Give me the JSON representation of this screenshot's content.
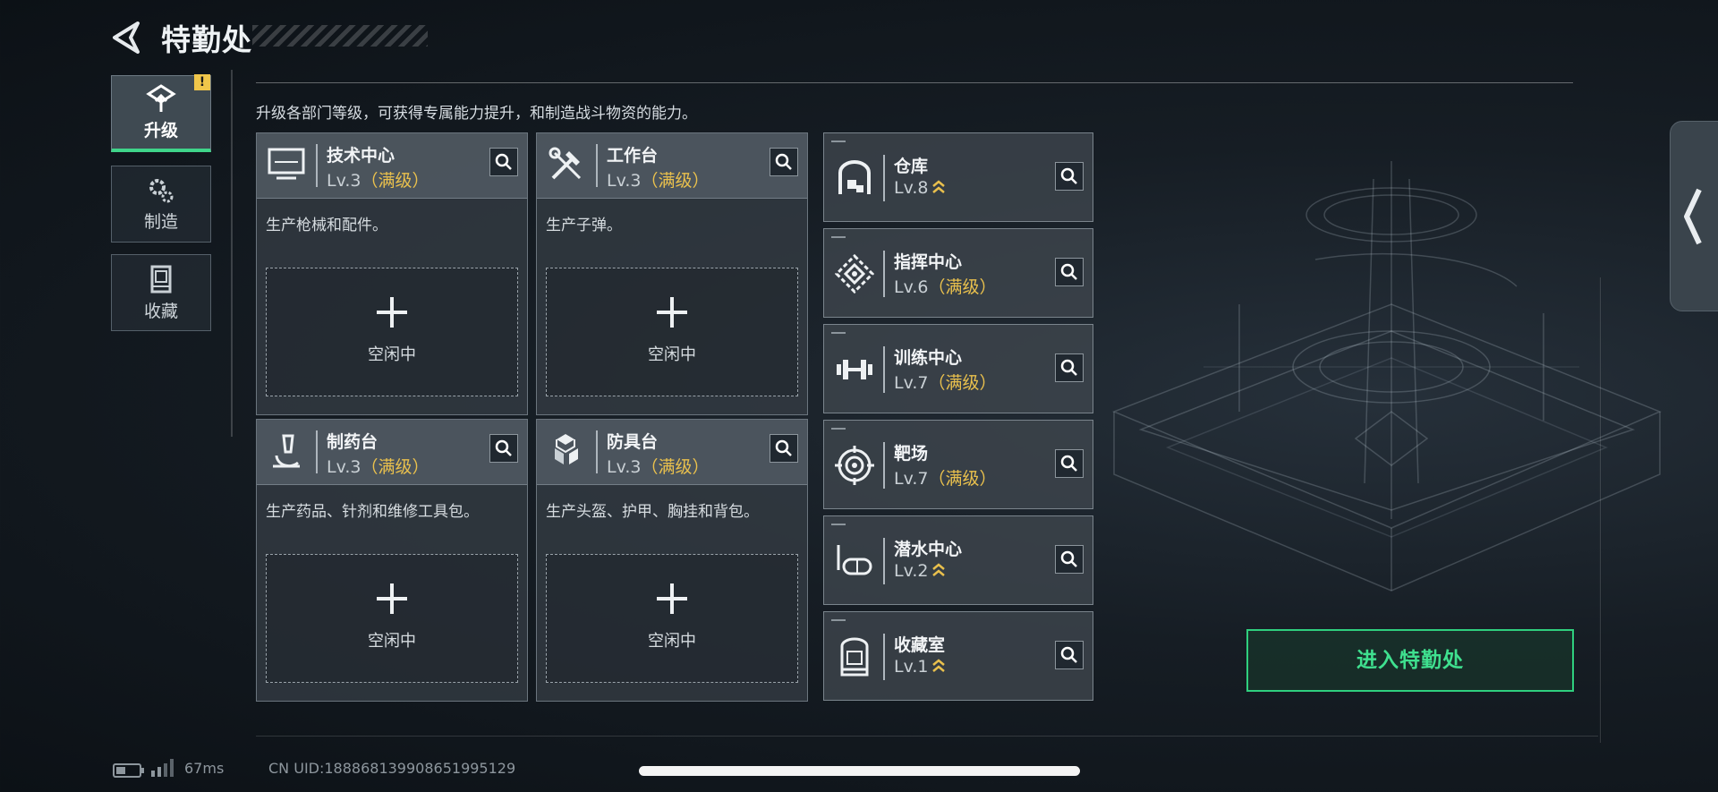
{
  "header": {
    "title": "特勤处"
  },
  "sidebar": {
    "items": [
      {
        "label": "升级",
        "active": true,
        "badge": "!"
      },
      {
        "label": "制造",
        "active": false
      },
      {
        "label": "收藏",
        "active": false
      }
    ]
  },
  "main": {
    "description": "升级各部门等级，可获得专属能力提升，和制造战斗物资的能力。",
    "workshops": [
      {
        "name": "技术中心",
        "level": "Lv.3",
        "max_tag": "（满级）",
        "desc": "生产枪械和配件。",
        "slot": "空闲中",
        "icon": "computer-icon"
      },
      {
        "name": "工作台",
        "level": "Lv.3",
        "max_tag": "（满级）",
        "desc": "生产子弹。",
        "slot": "空闲中",
        "icon": "tools-icon"
      },
      {
        "name": "制药台",
        "level": "Lv.3",
        "max_tag": "（满级）",
        "desc": "生产药品、针剂和维修工具包。",
        "slot": "空闲中",
        "icon": "microscope-icon"
      },
      {
        "name": "防具台",
        "level": "Lv.3",
        "max_tag": "（满级）",
        "desc": "生产头盔、护甲、胸挂和背包。",
        "slot": "空闲中",
        "icon": "armor-cubes-icon"
      }
    ],
    "facilities": [
      {
        "name": "仓库",
        "level": "Lv.8",
        "max_tag": "",
        "upgradable": true,
        "icon": "warehouse-icon"
      },
      {
        "name": "指挥中心",
        "level": "Lv.6",
        "max_tag": "（满级）",
        "upgradable": false,
        "icon": "command-icon"
      },
      {
        "name": "训练中心",
        "level": "Lv.7",
        "max_tag": "（满级）",
        "upgradable": false,
        "icon": "dumbbell-icon"
      },
      {
        "name": "靶场",
        "level": "Lv.7",
        "max_tag": "（满级）",
        "upgradable": false,
        "icon": "target-icon"
      },
      {
        "name": "潜水中心",
        "level": "Lv.2",
        "max_tag": "",
        "upgradable": true,
        "icon": "diving-mask-icon"
      },
      {
        "name": "收藏室",
        "level": "Lv.1",
        "max_tag": "",
        "upgradable": true,
        "icon": "display-case-icon"
      }
    ],
    "enter_label": "进入特勤处"
  },
  "status_bar": {
    "ping": "67ms",
    "uid": "CN UID:18886813990865199512​9"
  },
  "colors": {
    "accent_green": "#3fe08f",
    "max_gold": "#e9c04d",
    "badge_yellow": "#f0c64a"
  }
}
